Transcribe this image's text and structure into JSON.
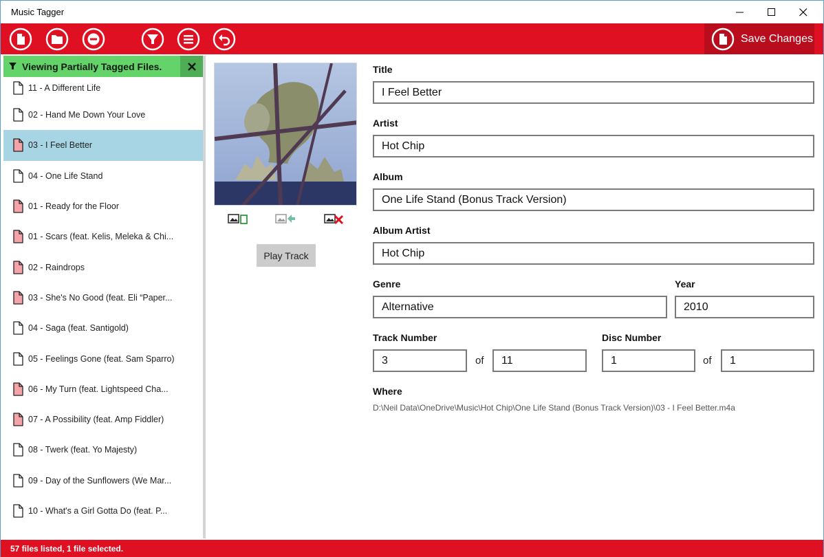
{
  "window": {
    "title": "Music Tagger"
  },
  "toolbar": {
    "buttons": [
      "new-file-icon",
      "open-folder-icon",
      "remove-icon",
      "filter-icon",
      "list-icon",
      "undo-icon"
    ],
    "save_label": "Save Changes"
  },
  "filter": {
    "text": "Viewing Partially Tagged Files."
  },
  "files": [
    {
      "name": "11 - A Different Life",
      "tagged": "full"
    },
    {
      "name": "02 - Hand Me Down Your Love",
      "tagged": "full"
    },
    {
      "name": "03 - I Feel Better",
      "tagged": "partial",
      "selected": true
    },
    {
      "name": "04 - One Life Stand",
      "tagged": "full"
    },
    {
      "name": "01 - Ready for the Floor",
      "tagged": "partial"
    },
    {
      "name": "01 - Scars (feat. Kelis, Meleka & Chi...",
      "tagged": "partial"
    },
    {
      "name": "02 - Raindrops",
      "tagged": "partial"
    },
    {
      "name": "03 - She's No Good (feat. Eli “Paper...",
      "tagged": "partial"
    },
    {
      "name": "04 - Saga (feat. Santigold)",
      "tagged": "full"
    },
    {
      "name": "05 - Feelings Gone (feat. Sam Sparro)",
      "tagged": "full"
    },
    {
      "name": "06 - My Turn (feat. Lightspeed Cha...",
      "tagged": "partial"
    },
    {
      "name": "07 - A Possibility (feat. Amp Fiddler)",
      "tagged": "partial"
    },
    {
      "name": "08 - Twerk (feat. Yo Majesty)",
      "tagged": "full"
    },
    {
      "name": "09 - Day of the Sunflowers (We Mar...",
      "tagged": "full"
    },
    {
      "name": "10 - What's a Girl Gotta Do  (feat. P...",
      "tagged": "full"
    }
  ],
  "artwork": {
    "play_label": "Play Track"
  },
  "form": {
    "title_label": "Title",
    "title": "I Feel Better",
    "artist_label": "Artist",
    "artist": "Hot Chip",
    "album_label": "Album",
    "album": "One Life Stand (Bonus Track Version)",
    "album_artist_label": "Album Artist",
    "album_artist": "Hot Chip",
    "genre_label": "Genre",
    "genre": "Alternative",
    "year_label": "Year",
    "year": "2010",
    "track_label": "Track Number",
    "track": "3",
    "track_total": "11",
    "disc_label": "Disc Number",
    "disc": "1",
    "disc_total": "1",
    "of_label": "of",
    "where_label": "Where",
    "where": "D:\\Neil Data\\OneDrive\\Music\\Hot Chip\\One Life Stand (Bonus Track Version)\\03 - I Feel Better.m4a"
  },
  "status": {
    "text": "57 files listed, 1 file selected."
  },
  "colors": {
    "accent": "#e01023",
    "filter_green": "#63d36a",
    "selection": "#a7d5e3",
    "partial_file": "#f4a3a8"
  }
}
